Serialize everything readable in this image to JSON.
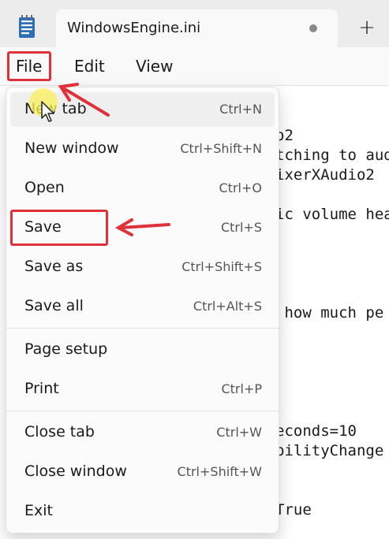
{
  "window": {
    "tab_title": "WindowsEngine.ini",
    "new_tab_symbol": "+"
  },
  "menubar": {
    "file": "File",
    "edit": "Edit",
    "view": "View"
  },
  "editor": {
    "lines": [
      "o2",
      "tching to aud",
      "ixerXAudio2",
      "ic volume hea",
      " how much pe",
      "econds=10",
      "bilityChange",
      "True"
    ]
  },
  "file_menu": {
    "items": [
      {
        "label": "New tab",
        "shortcut": "Ctrl+N"
      },
      {
        "label": "New window",
        "shortcut": "Ctrl+Shift+N"
      },
      {
        "label": "Open",
        "shortcut": "Ctrl+O"
      },
      {
        "label": "Save",
        "shortcut": "Ctrl+S"
      },
      {
        "label": "Save as",
        "shortcut": "Ctrl+Shift+S"
      },
      {
        "label": "Save all",
        "shortcut": "Ctrl+Alt+S"
      },
      {
        "label": "Page setup",
        "shortcut": ""
      },
      {
        "label": "Print",
        "shortcut": "Ctrl+P"
      },
      {
        "label": "Close tab",
        "shortcut": "Ctrl+W"
      },
      {
        "label": "Close window",
        "shortcut": "Ctrl+Shift+W"
      },
      {
        "label": "Exit",
        "shortcut": ""
      }
    ]
  },
  "colors": {
    "annotation_red": "#e0303a",
    "cursor_halo": "#faf05a"
  }
}
